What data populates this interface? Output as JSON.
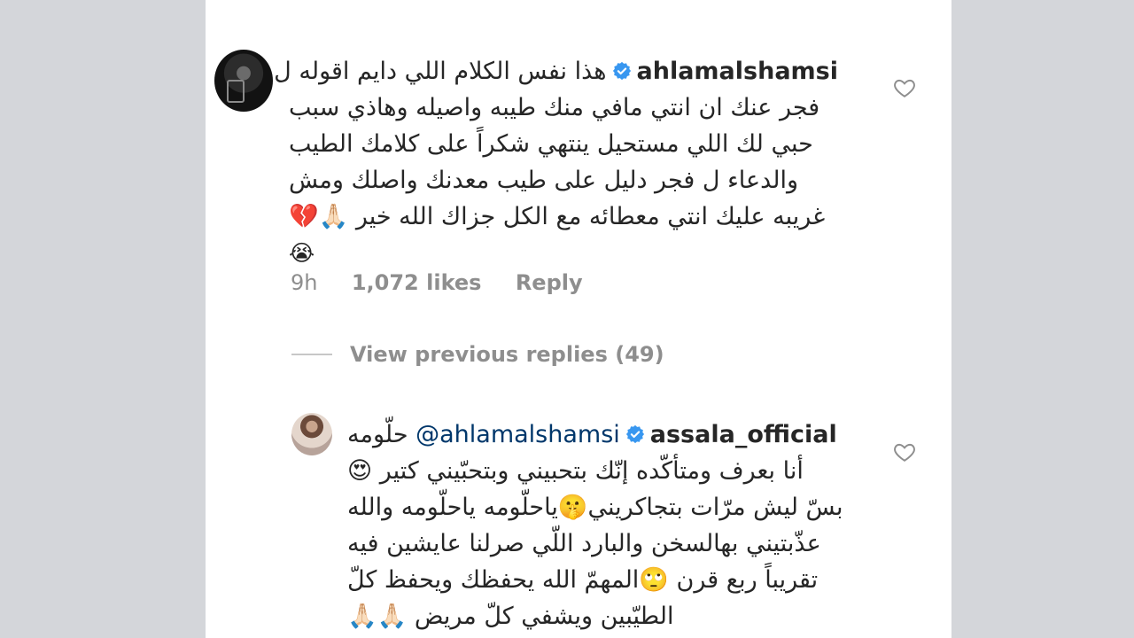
{
  "comment1": {
    "username": "ahlamalshamsi",
    "lines": [
      "هذا نفس الكلام اللي دايم اقوله ل",
      "فجر عنك ان انتي مافي منك طيبه واصيله وهاذي سبب",
      "حبي لك اللي مستحيل ينتهي شكراً على كلامك الطيب",
      "والدعاء ل فجر دليل على طيب معدنك واصلك ومش",
      "غريبه عليك انتي معطائه مع الكل جزاك الله خير 🙏🏻💔",
      "😭"
    ],
    "time": "9h",
    "likes": "1,072 likes",
    "reply": "Reply"
  },
  "view_replies": "View previous replies (49)",
  "comment2": {
    "username": "assala_official",
    "mention": "@ahlamalshamsi",
    "first_word": "حلّومه",
    "lines": [
      "أنا بعرف ومتأكّده إنّك بتحبيني وبتحبّيني كتير 😍",
      "بسّ ليش مرّات بتجاكريني🤫ياحلّومه ياحلّومه والله",
      "عذّبتيني بهالسخن والبارد اللّي صرلنا عايشين فيه",
      "تقريباً ربع قرن 🙄المهمّ الله يحفظك ويحفظ كلّ",
      "الطيّبين ويشفي كلّ مريض 🙏🏻🙏🏻"
    ]
  },
  "colors": {
    "background": "#d4d6da",
    "panel": "#ffffff",
    "text": "#262626",
    "muted": "#8e8e8e",
    "mention": "#00376b",
    "verified": "#3897f0"
  },
  "icons": {
    "verified": "verified-badge-icon",
    "like": "heart-outline-icon"
  }
}
